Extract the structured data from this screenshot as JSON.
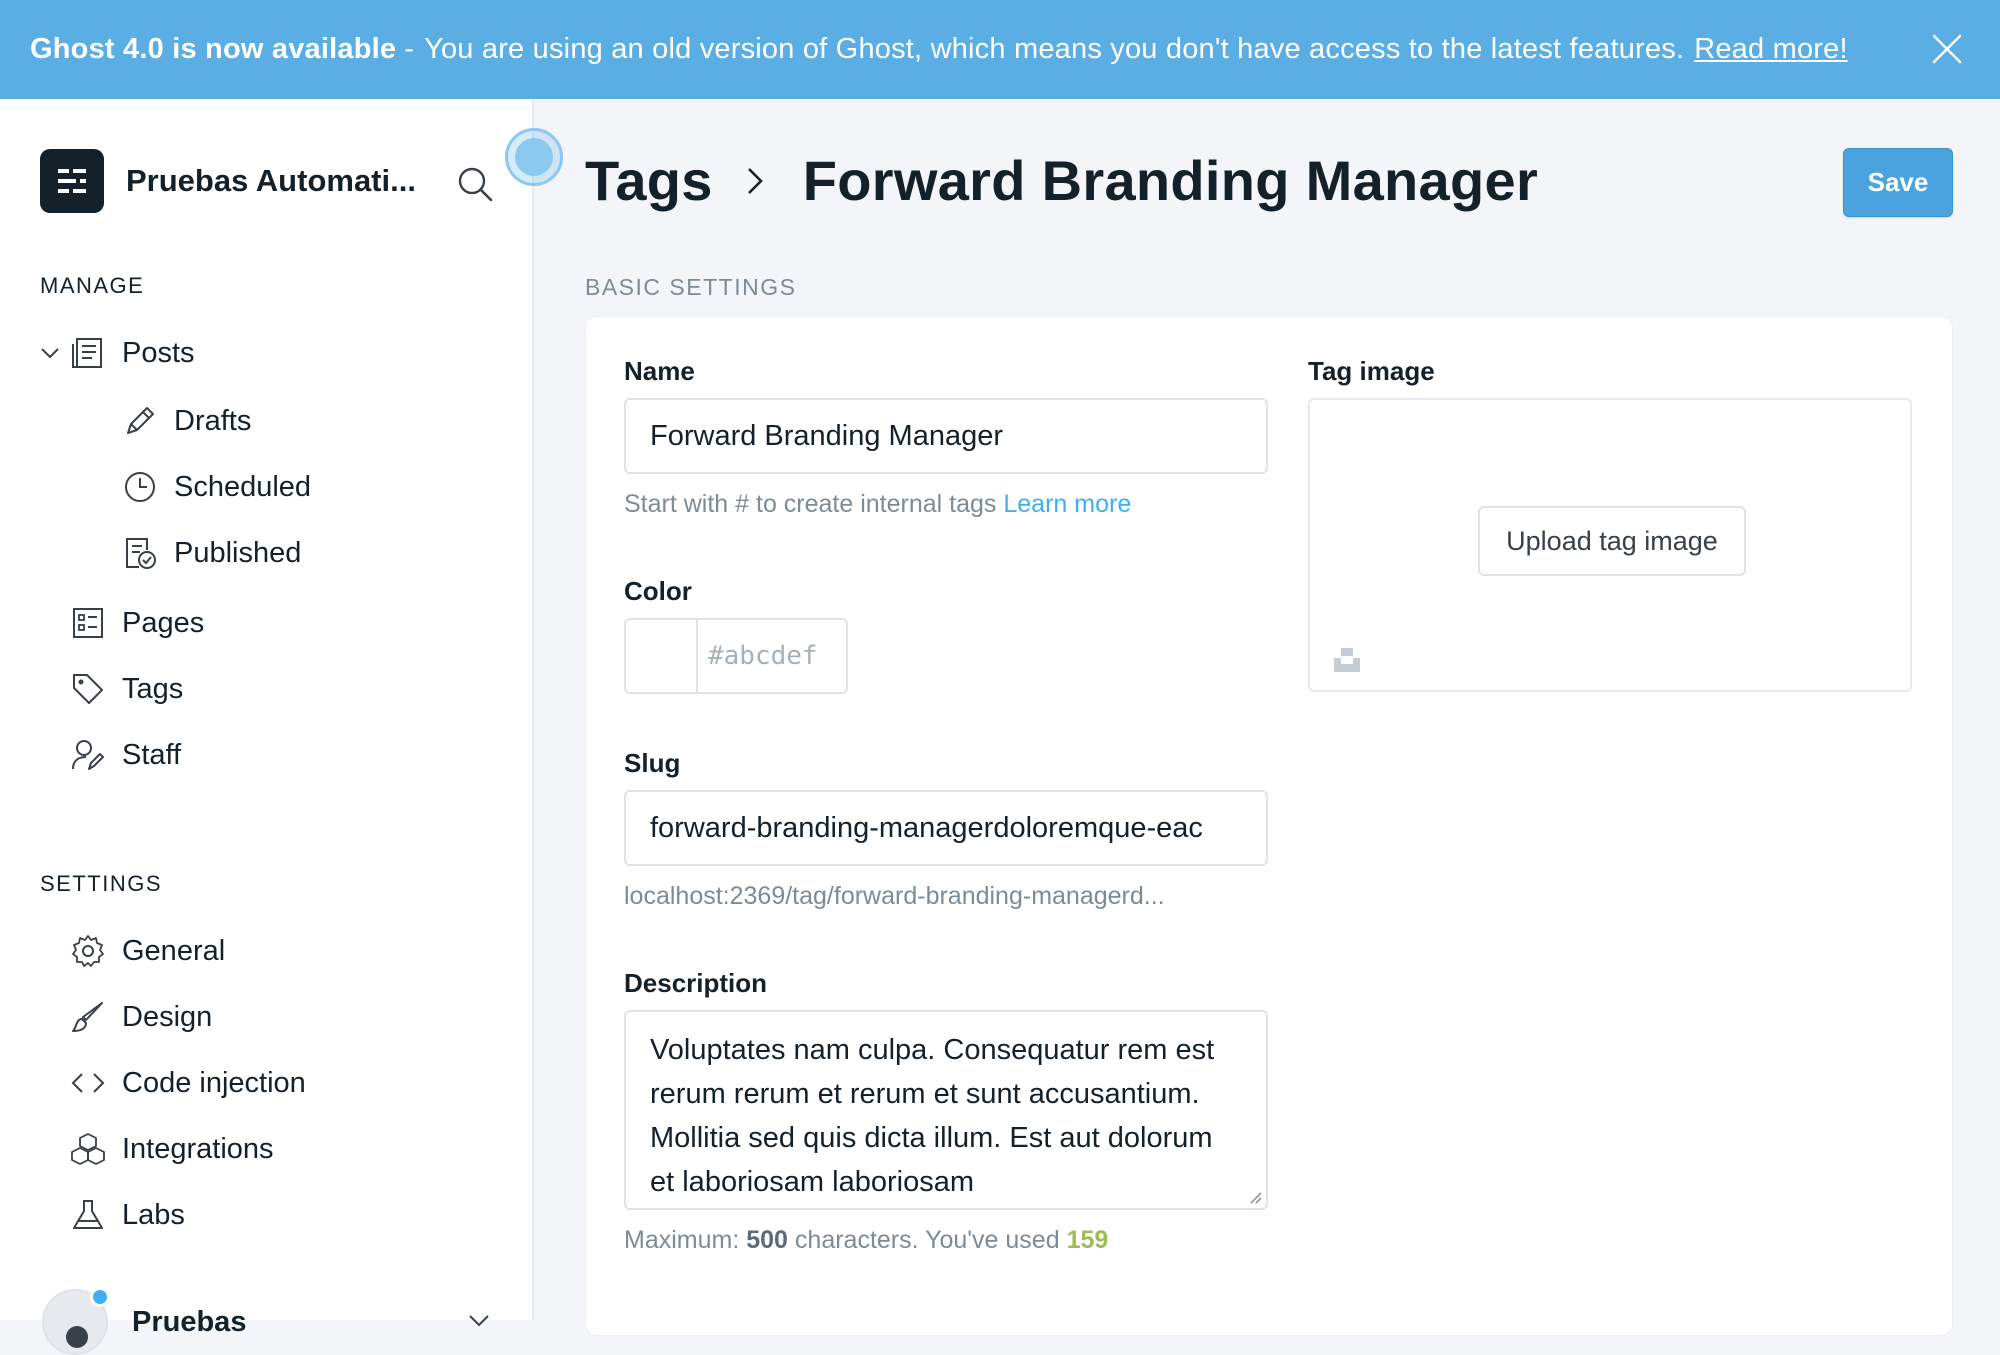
{
  "banner": {
    "title": "Ghost 4.0 is now available",
    "separator": "-",
    "message": "You are using an old version of Ghost, which means you don't have access to the latest features.",
    "link": "Read more!"
  },
  "sidebar": {
    "site_name": "Pruebas Automati...",
    "manage_label": "MANAGE",
    "settings_label": "SETTINGS",
    "manage_items": [
      {
        "label": "Posts",
        "icon": "posts-icon"
      },
      {
        "label": "Drafts",
        "icon": "pencil-icon"
      },
      {
        "label": "Scheduled",
        "icon": "clock-icon"
      },
      {
        "label": "Published",
        "icon": "published-icon"
      },
      {
        "label": "Pages",
        "icon": "pages-icon"
      },
      {
        "label": "Tags",
        "icon": "tag-icon"
      },
      {
        "label": "Staff",
        "icon": "staff-icon"
      }
    ],
    "settings_items": [
      {
        "label": "General",
        "icon": "gear-icon"
      },
      {
        "label": "Design",
        "icon": "brush-icon"
      },
      {
        "label": "Code injection",
        "icon": "code-icon"
      },
      {
        "label": "Integrations",
        "icon": "integrations-icon"
      },
      {
        "label": "Labs",
        "icon": "flask-icon"
      }
    ],
    "user_name": "Pruebas"
  },
  "header": {
    "breadcrumb_root": "Tags",
    "breadcrumb_current": "Forward Branding Manager",
    "save_label": "Save"
  },
  "form": {
    "section_label": "BASIC SETTINGS",
    "name_label": "Name",
    "name_value": "Forward Branding Manager",
    "name_hint": "Start with # to create internal tags",
    "name_hint_link": "Learn more",
    "color_label": "Color",
    "color_placeholder": "#abcdef",
    "slug_label": "Slug",
    "slug_value": "forward-branding-managerdoloremque-eac",
    "slug_url": "localhost:2369/tag/forward-branding-managerd...",
    "description_label": "Description",
    "description_value": "Voluptates nam culpa. Consequatur rem est rerum rerum et rerum et sunt accusantium. Mollitia sed quis dicta illum. Est aut dolorum et laboriosam laboriosam",
    "desc_hint_prefix": "Maximum:",
    "desc_max": "500",
    "desc_hint_mid": "characters. You've used",
    "desc_used": "159",
    "tag_image_label": "Tag image",
    "upload_label": "Upload tag image"
  },
  "colors": {
    "banner": "#5baee3",
    "save_button": "#4aa3df",
    "link": "#3eb0ef",
    "count_used": "#9fbb58"
  }
}
